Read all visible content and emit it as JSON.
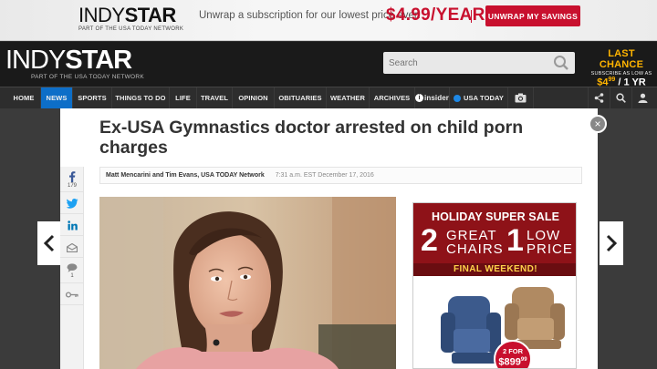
{
  "promo": {
    "logo_light": "INDY",
    "logo_bold": "STAR",
    "logo_sub": "PART OF THE USA TODAY NETWORK",
    "text": "Unwrap a subscription for our lowest price ever:",
    "price": "$4.99/YEAR",
    "button": "UNWRAP MY SAVINGS"
  },
  "masthead": {
    "logo_light": "INDY",
    "logo_bold": "STAR",
    "logo_sub": "PART OF THE USA TODAY NETWORK",
    "search_placeholder": "Search",
    "last_chance": "LAST CHANCE",
    "last_chance_sub": "SUBSCRIBE AS LOW AS",
    "last_chance_price": "$4",
    "last_chance_cents": "99",
    "last_chance_per": "/ 1 YR"
  },
  "nav": {
    "items": [
      "HOME",
      "NEWS",
      "SPORTS",
      "THINGS TO DO",
      "LIFE",
      "TRAVEL",
      "OPINION",
      "OBITUARIES",
      "WEATHER",
      "ARCHIVES"
    ],
    "insider": "insider",
    "usa_today": "USA TODAY",
    "active": "NEWS"
  },
  "article": {
    "headline": "Ex-USA Gymnastics doctor arrested on child porn charges",
    "authors": "Matt Mencarini and Tim Evans, USA TODAY Network",
    "timestamp": "7:31 a.m. EST December 17, 2016",
    "facebook_count": "179",
    "comment_count": "1"
  },
  "ad": {
    "headline": "HOLIDAY SUPER SALE",
    "num1": "2",
    "words1a": "GREAT",
    "words1b": "CHAIRS",
    "num2": "1",
    "words2a": "LOW",
    "words2b": "PRICE",
    "final": "FINAL WEEKEND!",
    "badge_top": "2 FOR",
    "badge_price": "$899",
    "badge_cents": "99"
  },
  "colors": {
    "brand_red": "#c8102e",
    "nav_active": "#0d6ec8",
    "ad_red": "#8e1218",
    "last_chance": "#ffb400"
  },
  "icons": [
    "search-icon",
    "share-icon",
    "user-icon",
    "camera-icon",
    "facebook-icon",
    "twitter-icon",
    "linkedin-icon",
    "email-icon",
    "comment-icon",
    "key-icon",
    "close-icon",
    "chevron-left-icon",
    "chevron-right-icon"
  ]
}
